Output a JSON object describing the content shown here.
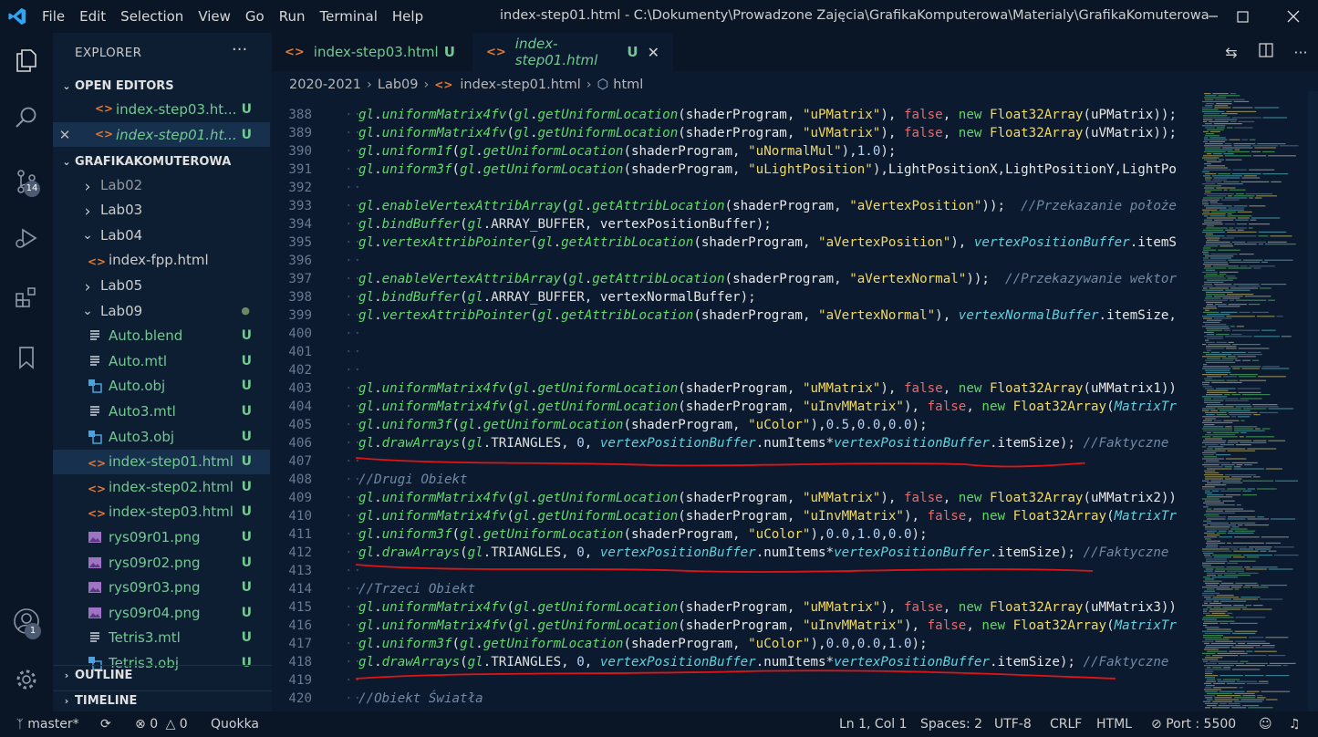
{
  "window": {
    "title": "index-step01.html - C:\\Dokumenty\\Prowadzone Zajęcia\\GrafikaKomputerowa\\Materialy\\GrafikaKomuterowa",
    "menu": [
      "File",
      "Edit",
      "Selection",
      "View",
      "Go",
      "Run",
      "Terminal",
      "Help"
    ]
  },
  "activity": {
    "scm_badge": "14",
    "accounts_badge": "1"
  },
  "sidebar": {
    "header": "EXPLORER",
    "open_editors_label": "OPEN EDITORS",
    "open_editors": [
      {
        "name": "index-step03.ht...",
        "status": "U"
      },
      {
        "name": "index-step01.ht...",
        "status": "U"
      }
    ],
    "workspace_label": "GRAFIKAKOMUTEROWA",
    "tree": [
      {
        "name": "Lab02",
        "kind": "folder"
      },
      {
        "name": "Lab03",
        "kind": "folder"
      },
      {
        "name": "Lab04",
        "kind": "folder-open"
      },
      {
        "name": "index-fpp.html",
        "kind": "html"
      },
      {
        "name": "Lab05",
        "kind": "folder"
      },
      {
        "name": "Lab09",
        "kind": "folder-open"
      },
      {
        "name": "Auto.blend",
        "kind": "lines",
        "status": "U"
      },
      {
        "name": "Auto.mtl",
        "kind": "lines",
        "status": "U"
      },
      {
        "name": "Auto.obj",
        "kind": "obj",
        "status": "U"
      },
      {
        "name": "Auto3.mtl",
        "kind": "lines",
        "status": "U"
      },
      {
        "name": "Auto3.obj",
        "kind": "obj",
        "status": "U"
      },
      {
        "name": "index-step01.html",
        "kind": "html",
        "status": "U"
      },
      {
        "name": "index-step02.html",
        "kind": "html",
        "status": "U"
      },
      {
        "name": "index-step03.html",
        "kind": "html",
        "status": "U"
      },
      {
        "name": "rys09r01.png",
        "kind": "img",
        "status": "U"
      },
      {
        "name": "rys09r02.png",
        "kind": "img",
        "status": "U"
      },
      {
        "name": "rys09r03.png",
        "kind": "img",
        "status": "U"
      },
      {
        "name": "rys09r04.png",
        "kind": "img",
        "status": "U"
      },
      {
        "name": "Tetris3.mtl",
        "kind": "lines",
        "status": "U"
      },
      {
        "name": "Tetris3.obj",
        "kind": "obj",
        "status": "U"
      }
    ],
    "outline_label": "OUTLINE",
    "timeline_label": "TIMELINE"
  },
  "tabs": [
    {
      "name": "index-step03.html",
      "status": "U",
      "icon": "<>"
    },
    {
      "name": "index-step01.html",
      "status": "U",
      "icon": "<>"
    }
  ],
  "breadcrumb": [
    "2020-2021",
    "Lab09",
    "index-step01.html",
    "html"
  ],
  "code": {
    "first_line": 388,
    "lines": [
      "gl.uniformMatrix4fv(gl.getUniformLocation(shaderProgram, \"uPMatrix\"), false, new Float32Array(uPMatrix));",
      "gl.uniformMatrix4fv(gl.getUniformLocation(shaderProgram, \"uVMatrix\"), false, new Float32Array(uVMatrix));",
      "gl.uniform1f(gl.getUniformLocation(shaderProgram, \"uNormalMul\"),1.0);",
      "gl.uniform3f(gl.getUniformLocation(shaderProgram, \"uLightPosition\"),LightPositionX,LightPositionY,LightPo",
      "",
      "gl.enableVertexAttribArray(gl.getAttribLocation(shaderProgram, \"aVertexPosition\"));  //Przekazanie położe",
      "gl.bindBuffer(gl.ARRAY_BUFFER, vertexPositionBuffer);",
      "gl.vertexAttribPointer(gl.getAttribLocation(shaderProgram, \"aVertexPosition\"), vertexPositionBuffer.itemS",
      "",
      "gl.enableVertexAttribArray(gl.getAttribLocation(shaderProgram, \"aVertexNormal\"));  //Przekazywanie wektor",
      "gl.bindBuffer(gl.ARRAY_BUFFER, vertexNormalBuffer);",
      "gl.vertexAttribPointer(gl.getAttribLocation(shaderProgram, \"aVertexNormal\"), vertexNormalBuffer.itemSize,",
      "",
      "",
      "",
      "gl.uniformMatrix4fv(gl.getUniformLocation(shaderProgram, \"uMMatrix\"), false, new Float32Array(uMMatrix1))",
      "gl.uniformMatrix4fv(gl.getUniformLocation(shaderProgram, \"uInvMMatrix\"), false, new Float32Array(MatrixTr",
      "gl.uniform3f(gl.getUniformLocation(shaderProgram, \"uColor\"),0.5,0.0,0.0);",
      "gl.drawArrays(gl.TRIANGLES, 0, vertexPositionBuffer.numItems*vertexPositionBuffer.itemSize); //Faktyczne",
      "",
      "//Drugi Obiekt",
      "gl.uniformMatrix4fv(gl.getUniformLocation(shaderProgram, \"uMMatrix\"), false, new Float32Array(uMMatrix2))",
      "gl.uniformMatrix4fv(gl.getUniformLocation(shaderProgram, \"uInvMMatrix\"), false, new Float32Array(MatrixTr",
      "gl.uniform3f(gl.getUniformLocation(shaderProgram, \"uColor\"),0.0,1.0,0.0);",
      "gl.drawArrays(gl.TRIANGLES, 0, vertexPositionBuffer.numItems*vertexPositionBuffer.itemSize); //Faktyczne",
      "",
      "//Trzeci Obiekt",
      "gl.uniformMatrix4fv(gl.getUniformLocation(shaderProgram, \"uMMatrix\"), false, new Float32Array(uMMatrix3))",
      "gl.uniformMatrix4fv(gl.getUniformLocation(shaderProgram, \"uInvMMatrix\"), false, new Float32Array(MatrixTr",
      "gl.uniform3f(gl.getUniformLocation(shaderProgram, \"uColor\"),0.0,0.0,1.0);",
      "gl.drawArrays(gl.TRIANGLES, 0, vertexPositionBuffer.numItems*vertexPositionBuffer.itemSize); //Faktyczne",
      "",
      "//Obiekt Światła"
    ]
  },
  "status": {
    "branch": "master*",
    "errors": "0",
    "warnings": "0",
    "extension": "Quokka",
    "position": "Ln 1, Col 1",
    "spaces": "Spaces: 2",
    "encoding": "UTF-8",
    "eol": "CRLF",
    "language": "HTML",
    "port": "Port : 5500"
  },
  "colors": {
    "accent": "#0a1626",
    "editor_bg": "#0b1a2e",
    "untracked": "#73c991",
    "html_icon": "#e37933",
    "ink": "#e01515"
  }
}
